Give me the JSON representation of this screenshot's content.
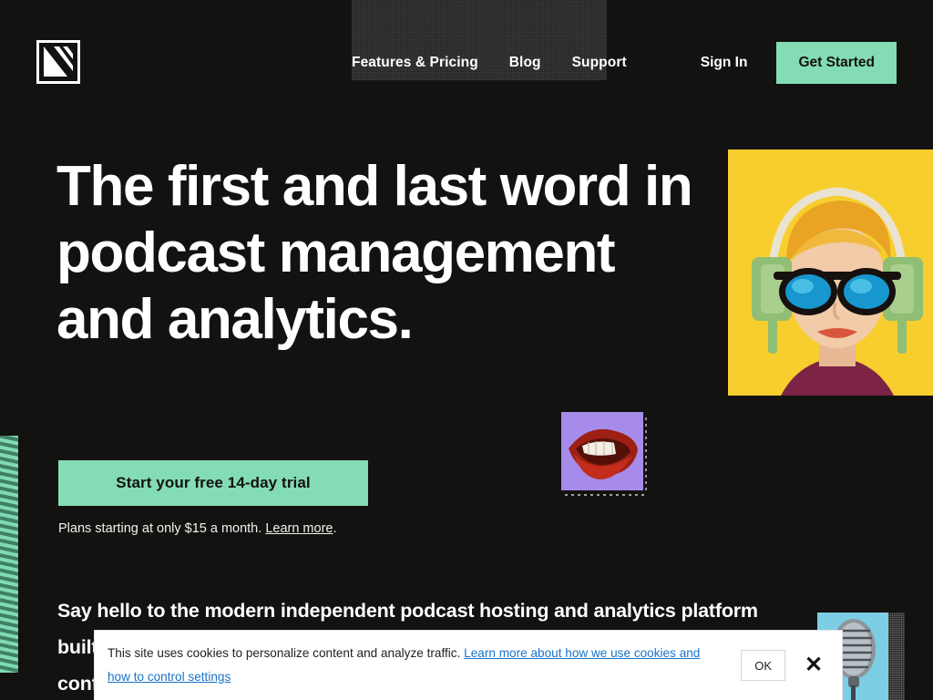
{
  "theme": {
    "background": "#121210",
    "accent_mint": "#84DCB4",
    "text_light": "#FFFFFF",
    "link_blue": "#1A73C8",
    "yellow": "#F7CE2E",
    "purple": "#A78BEA",
    "cyan": "#7CCEE4"
  },
  "header": {
    "logo_name": "podcast-logo-mark",
    "nav": [
      {
        "label": "Features & Pricing"
      },
      {
        "label": "Blog"
      },
      {
        "label": "Support"
      }
    ],
    "sign_in_label": "Sign In",
    "get_started_label": "Get Started"
  },
  "hero": {
    "headline": "The first and last word in podcast management and analytics.",
    "cta_label": "Start your free 14-day trial",
    "plans_prefix": "Plans starting at only $15 a month. ",
    "plans_link": "Learn more",
    "plans_suffix": ".",
    "subhead": "Say hello to the modern independent podcast hosting and analytics platform built for podcasters who want to grow their audience and publish with confidence."
  },
  "media": {
    "woman_image": "woman-with-headphones-photo",
    "mouth_image": "open-mouth-lips-photo",
    "microphone_image": "vintage-microphone-photo",
    "stripes": "teal-wave-stripe-pattern"
  },
  "cookie_banner": {
    "message": "This site uses cookies to personalize content and analyze traffic. ",
    "link_text": "Learn more about how we use cookies and how to control settings",
    "ok_label": "OK",
    "close_label": "✕"
  }
}
